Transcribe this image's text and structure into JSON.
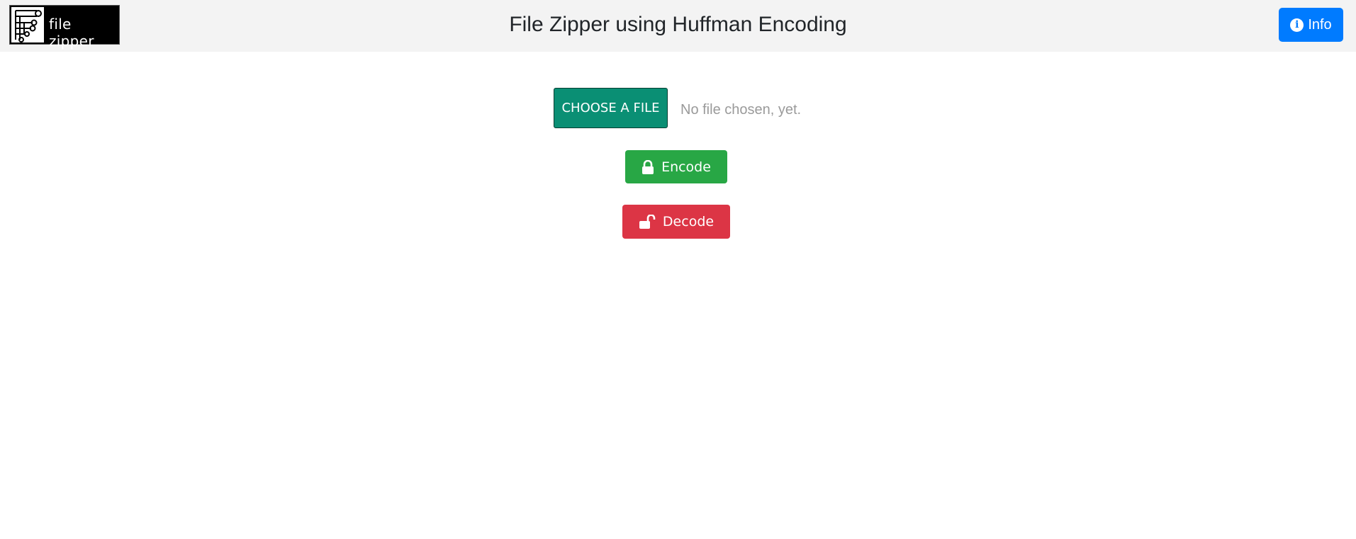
{
  "header": {
    "logo_text": "file zipper",
    "title": "File Zipper using Huffman Encoding",
    "info_label": "Info"
  },
  "main": {
    "choose_label": "CHOOSE A FILE",
    "file_status": "No file chosen, yet.",
    "encode_label": "Encode",
    "decode_label": "Decode"
  },
  "icons": {
    "info": "info-circle-icon",
    "encode": "lock-icon",
    "decode": "unlock-icon"
  },
  "colors": {
    "navbar_bg": "#f3f3f3",
    "info": "#007bff",
    "choose": "#0a8f74",
    "encode": "#28a745",
    "decode": "#dc3545"
  }
}
